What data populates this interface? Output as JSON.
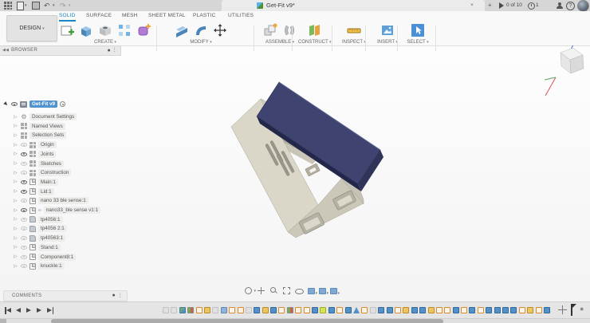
{
  "titlebar": {
    "tab_title": "Get-Fit v9*",
    "docs_badge": "0 of 10",
    "jobs_badge": "1",
    "close_tab": "×",
    "new_tab": "+",
    "help": "?"
  },
  "ribbon": {
    "design_button": "DESIGN",
    "tabs": [
      {
        "label": "SOLID",
        "active": true
      },
      {
        "label": "SURFACE",
        "active": false
      },
      {
        "label": "MESH",
        "active": false
      },
      {
        "label": "SHEET METAL",
        "active": false
      },
      {
        "label": "PLASTIC",
        "active": false
      },
      {
        "label": "UTILITIES",
        "active": false
      }
    ],
    "groups": [
      {
        "label": "CREATE",
        "icons": [
          "create-sketch",
          "extrude",
          "hole",
          "pattern",
          "form"
        ]
      },
      {
        "label": "MODIFY",
        "icons": [
          "press-pull",
          "fillet",
          "move"
        ]
      },
      {
        "label": "ASSEMBLE",
        "icons": [
          "new-component",
          "joint"
        ]
      },
      {
        "label": "CONSTRUCT",
        "icons": [
          "construction-plane"
        ]
      },
      {
        "label": "INSPECT",
        "icons": [
          "measure"
        ]
      },
      {
        "label": "INSERT",
        "icons": [
          "canvas"
        ]
      },
      {
        "label": "SELECT",
        "icons": [
          "select"
        ]
      }
    ]
  },
  "browser": {
    "title": "BROWSER",
    "root_label": "Get-Fit v9",
    "items": [
      {
        "label": "Document Settings",
        "icon": "gear",
        "eye": "none"
      },
      {
        "label": "Named Views",
        "icon": "grid",
        "eye": "none"
      },
      {
        "label": "Selection Sets",
        "icon": "grid",
        "eye": "none"
      },
      {
        "label": "Origin",
        "icon": "grid",
        "eye": "dim"
      },
      {
        "label": "Joints",
        "icon": "grid",
        "eye": "on"
      },
      {
        "label": "Sketches",
        "icon": "grid",
        "eye": "dim"
      },
      {
        "label": "Construction",
        "icon": "grid",
        "eye": "dim"
      },
      {
        "label": "Main:1",
        "icon": "component",
        "eye": "on"
      },
      {
        "label": "Lid:1",
        "icon": "component",
        "eye": "on"
      },
      {
        "label": "nano 33 ble sense:1",
        "icon": "component",
        "eye": "dim"
      },
      {
        "label": "nano33_ble sense v1:1",
        "icon": "linked",
        "eye": "on"
      },
      {
        "label": "tp4056:1",
        "icon": "body",
        "eye": "dim"
      },
      {
        "label": "tp4056 2:1",
        "icon": "body",
        "eye": "dim"
      },
      {
        "label": "tp40563:1",
        "icon": "body",
        "eye": "dim"
      },
      {
        "label": "Stand:1",
        "icon": "component",
        "eye": "dim"
      },
      {
        "label": "Component8:1",
        "icon": "component",
        "eye": "dim"
      },
      {
        "label": "knuckle:1",
        "icon": "component",
        "eye": "dim"
      }
    ]
  },
  "viewport": {
    "model": {
      "body_color": "#d9d6c8",
      "lid_color": "#3e4370"
    },
    "nav_items": [
      "orbit",
      "pan",
      "zoom",
      "fit",
      "look-at",
      "display-settings",
      "grid-snaps",
      "viewports"
    ]
  },
  "comments": {
    "title": "COMMENTS"
  },
  "timeline": {
    "playback": [
      "skip-start",
      "step-back",
      "play",
      "step-forward",
      "skip-end"
    ],
    "current_color": "#d7e34d",
    "features": [
      "dim",
      "dim",
      "component",
      "joint",
      "sketch",
      "gold",
      "dim",
      "flag",
      "sketch",
      "sketch",
      "dim",
      "box",
      "gold",
      "box",
      "sketch",
      "joint",
      "sketch",
      "sketch",
      "box",
      "current",
      "box",
      "sketch",
      "box",
      "triangle",
      "sketch",
      "dim",
      "box",
      "box",
      "sketch",
      "gold",
      "box",
      "box",
      "gold",
      "sketch",
      "sketch",
      "box",
      "sketch",
      "box",
      "sketch",
      "box",
      "box",
      "box",
      "box",
      "sketch",
      "gold",
      "sketch",
      "box"
    ]
  }
}
